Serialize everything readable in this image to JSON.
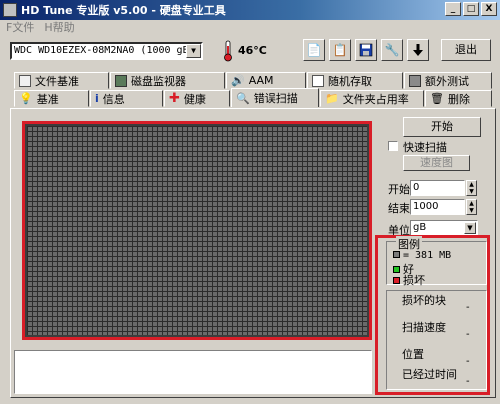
{
  "window": {
    "title": "HD Tune 专业版 v5.00 - 硬盘专业工具",
    "buttons": [
      "_",
      "□",
      "X"
    ]
  },
  "menubar": [
    "F文件",
    "H帮助"
  ],
  "toolbar": {
    "drive": "WDC WD10EZEX-08M2NA0 (1000 gB)",
    "temperature": "46°C",
    "exit_label": "退出"
  },
  "tabs_row1": [
    {
      "label": "文件基准",
      "icon": "file-benchmark-icon"
    },
    {
      "label": "磁盘监视器",
      "icon": "disk-monitor-icon"
    },
    {
      "label": "AAM",
      "icon": "speaker-icon"
    },
    {
      "label": "随机存取",
      "icon": "random-access-icon"
    },
    {
      "label": "额外测试",
      "icon": "extra-tests-icon"
    }
  ],
  "tabs_row2": [
    {
      "label": "基准",
      "icon": "benchmark-icon"
    },
    {
      "label": "信息",
      "icon": "info-icon"
    },
    {
      "label": "健康",
      "icon": "health-cross-icon"
    },
    {
      "label": "错误扫描",
      "icon": "magnifier-icon",
      "active": true
    },
    {
      "label": "文件夹占用率",
      "icon": "folder-icon"
    },
    {
      "label": "删除",
      "icon": "trash-icon"
    }
  ],
  "controls": {
    "start_label": "开始",
    "quick_scan_label": "快速扫描",
    "quick_scan_checked": false,
    "speed_map_label": "速度图",
    "begin_label": "开始",
    "begin_value": "0",
    "end_label": "结束",
    "end_value": "1000",
    "unit_label": "单位",
    "unit_value": "gB"
  },
  "legend": {
    "title": "图例",
    "block_size": "= 381 MB",
    "good_label": "好",
    "bad_label": "损坏",
    "colors": {
      "block": "#7a7a7a",
      "good": "#22c322",
      "bad": "#d81e28"
    }
  },
  "stats": {
    "damaged_blocks_label": "损坏的块",
    "damaged_blocks_value": "-",
    "scan_speed_label": "扫描速度",
    "scan_speed_value": "-",
    "position_label": "位置",
    "position_value": "-",
    "elapsed_label": "已经过时间",
    "elapsed_value": "-"
  },
  "colors": {
    "highlight": "#d81e28",
    "titlebar": "#0a246a"
  }
}
